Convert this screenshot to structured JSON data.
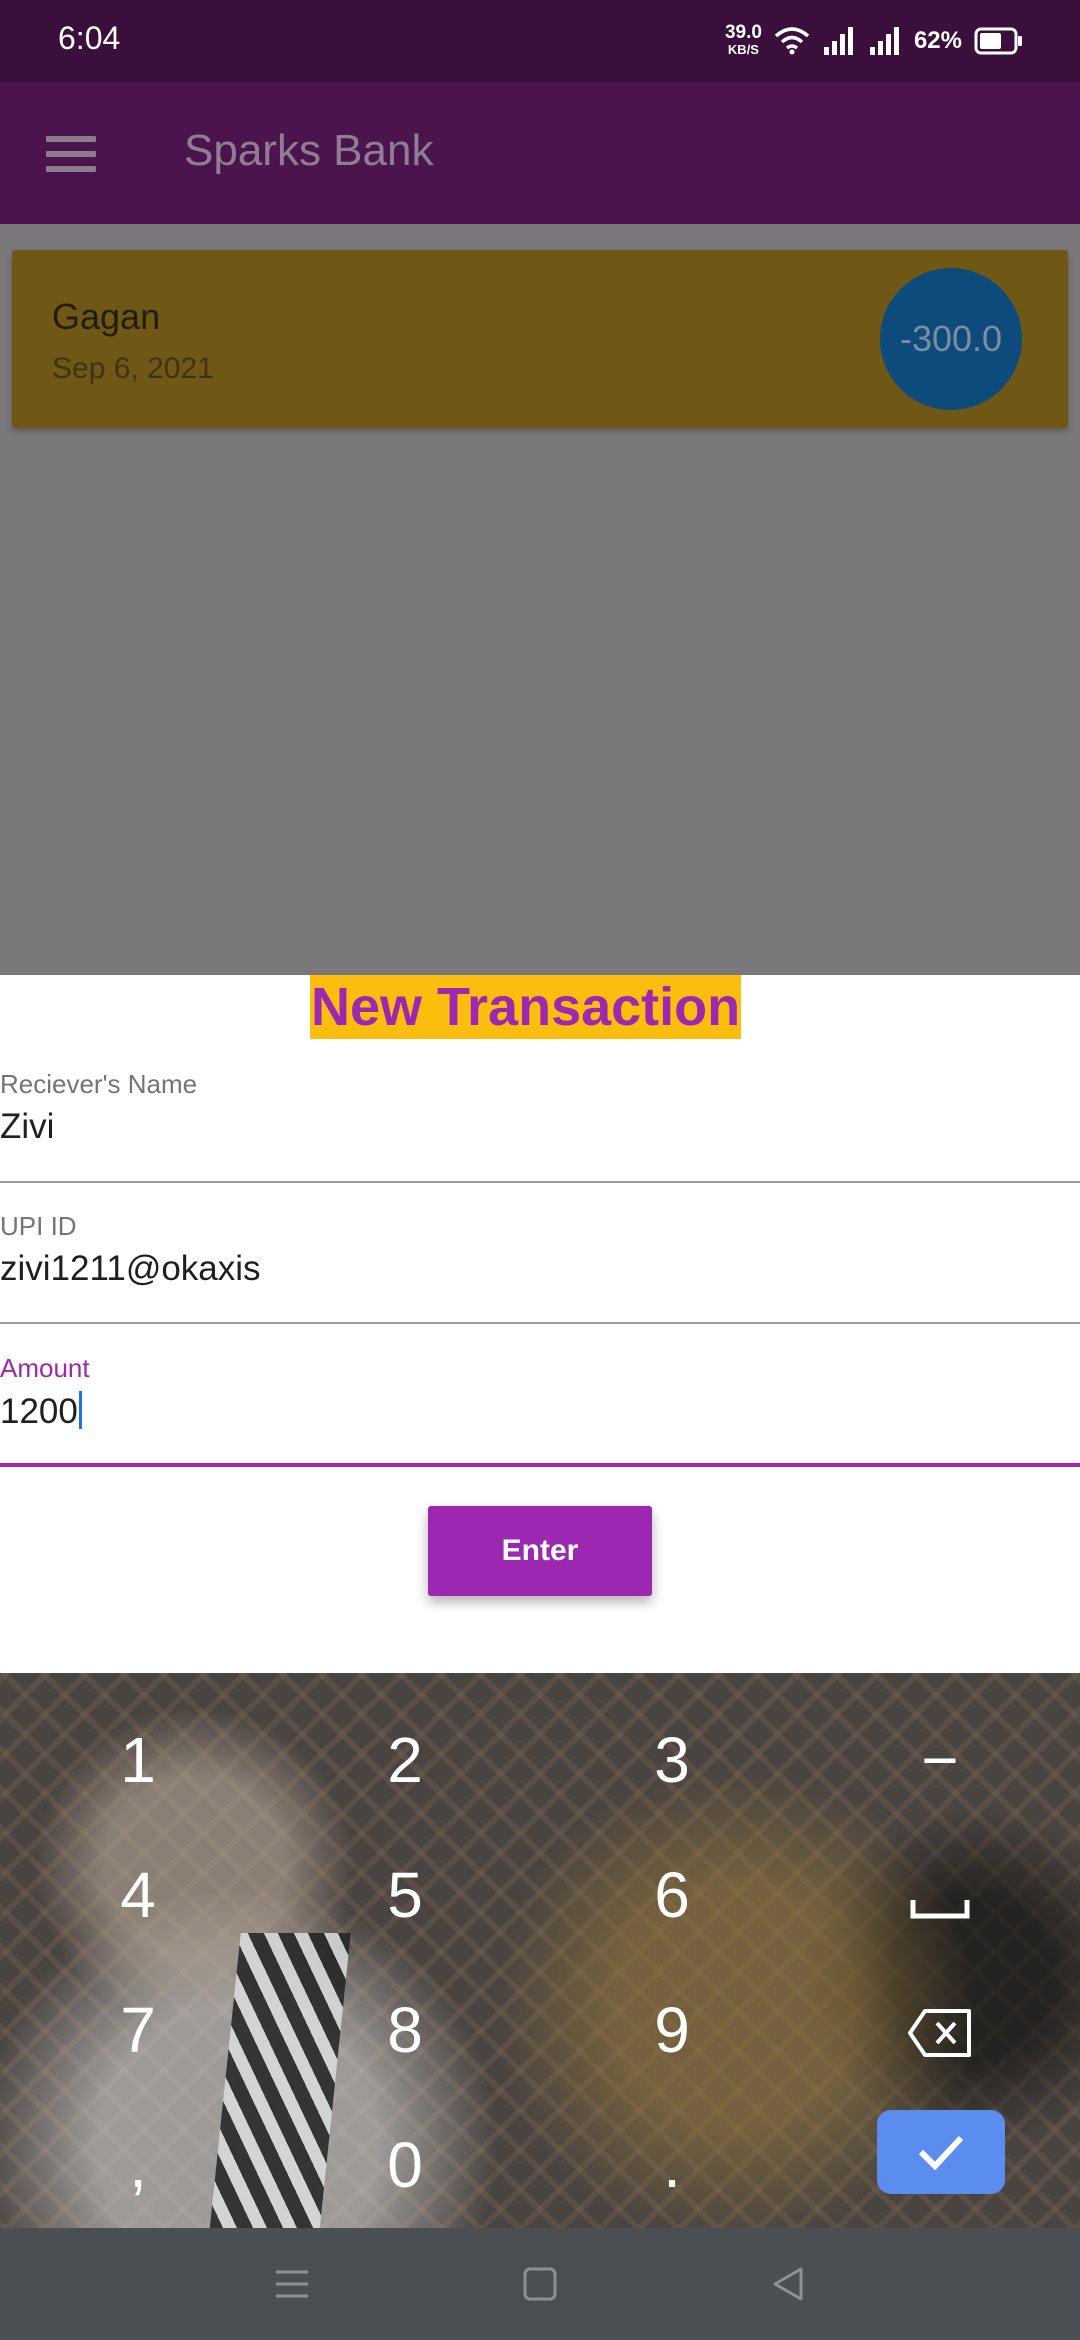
{
  "status_bar": {
    "time": "6:04",
    "net_speed": "39.0",
    "net_speed_unit": "KB/S",
    "battery": "62%"
  },
  "app_bar": {
    "title": "Sparks Bank",
    "menu_icon": "hamburger-menu-icon"
  },
  "transaction_card": {
    "name": "Gagan",
    "date": "Sep 6, 2021",
    "amount": "-300.0"
  },
  "sheet": {
    "title": "New Transaction",
    "fields": [
      {
        "label": "Reciever's Name",
        "value": "Zivi"
      },
      {
        "label": "UPI ID",
        "value": "zivi1211@okaxis"
      },
      {
        "label": "Amount",
        "value": "1200"
      }
    ],
    "submit_label": "Enter"
  },
  "keyboard": {
    "keys": [
      "1",
      "2",
      "3",
      "4",
      "5",
      "6",
      "7",
      "8",
      "9",
      ",",
      "0",
      "."
    ],
    "minus": "−",
    "space_icon": "space-bar-icon",
    "backspace_icon": "backspace-icon",
    "confirm_icon": "checkmark-icon"
  },
  "nav_bar": {
    "icons": [
      "recents-menu-icon",
      "home-square-icon",
      "back-triangle-icon"
    ]
  },
  "colors": {
    "status_bar": "#3a0f3c",
    "app_bar": "#4c144f",
    "accent": "#9c27b0",
    "title_highlight": "#fbbe0f",
    "card": "#6f5716",
    "badge": "#0d4b7d",
    "confirm_key": "#5b8def"
  }
}
